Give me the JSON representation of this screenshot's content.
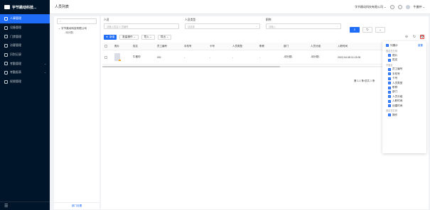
{
  "app": {
    "logo_text": "宇节跳动科技..."
  },
  "sidebar": {
    "items": [
      {
        "label": "人事管理",
        "active": true,
        "chevron": ""
      },
      {
        "label": "设备管理",
        "active": false,
        "chevron": ""
      },
      {
        "label": "门禁管理",
        "active": false,
        "chevron": ""
      },
      {
        "label": "访客管理",
        "active": false,
        "chevron": ""
      },
      {
        "label": "识别记录",
        "active": false,
        "chevron": ""
      },
      {
        "label": "考勤管理",
        "active": false,
        "chevron": "⌄"
      },
      {
        "label": "考勤报表",
        "active": false,
        "chevron": "⌄"
      },
      {
        "label": "权限管理",
        "active": false,
        "chevron": ""
      }
    ],
    "footer_icon": "menu-fold-icon"
  },
  "header": {
    "title": "人员列表",
    "company": "字节跳动科技有限公司 ⌄",
    "user": "牛傲仲 ⌄"
  },
  "tree": {
    "search_placeholder": "",
    "root": "字节跳动科技有限公司",
    "child": "-待分配-",
    "footer": "部门设置"
  },
  "filters": [
    {
      "label": "人员",
      "placeholder": "请输入姓名/人员编号",
      "dropdown": ""
    },
    {
      "label": "人员类型",
      "placeholder": "请选择",
      "dropdown": "⌄"
    },
    {
      "label": "职称",
      "placeholder": "请输入",
      "dropdown": "⌄"
    }
  ],
  "toolbar": {
    "add": "新增",
    "batch": "批量操作 ⌄",
    "import": "导入 ⌄",
    "export": "导出 ⌄"
  },
  "table": {
    "headers": [
      "照片",
      "姓名",
      "员工编号",
      "手机号",
      "卡号",
      "人员类型",
      "职称",
      "部门",
      "人员分组",
      "入职时间"
    ],
    "rows": [
      {
        "name": "牛傲仲",
        "emp_no": "001",
        "phone": "-",
        "card": "-",
        "type": "-",
        "title": "-",
        "dept": "-待分配-",
        "group": "-待分配-",
        "join_date": "2022-04-08 11:13:05"
      }
    ]
  },
  "pager": "第 1-1 条/总共 1 条",
  "column_settings": {
    "show_all": "列展示",
    "reset": "重置",
    "groups": [
      {
        "label": "固定在左侧",
        "items": [
          "照片",
          "姓名"
        ]
      },
      {
        "label": "不固定",
        "items": [
          "员工编号",
          "手机号",
          "卡号",
          "人员类型",
          "职称",
          "部门",
          "人员分组",
          "入职时间",
          "创建时间"
        ]
      },
      {
        "label": "固定在右侧",
        "items": [
          "操作"
        ]
      }
    ]
  },
  "colors": {
    "primary": "#1f6cf6",
    "sidebar_bg": "#001529",
    "highlight": "#e03c3c"
  }
}
